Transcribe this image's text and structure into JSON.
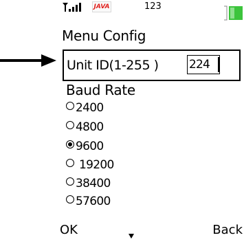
{
  "status_bar": {
    "signal_icon": "signal-strength-icon",
    "app_badge": "JAVA",
    "number": "123",
    "battery_icon": "battery-icon",
    "battery_color": "#3cc43c"
  },
  "screen": {
    "title": "Menu Config"
  },
  "form": {
    "unit_id_label": "Unit ID(1-255 )",
    "unit_id_value": "224",
    "baud_rate_label": "Baud Rate",
    "baud_options": [
      "2400",
      "4800",
      "9600",
      "19200",
      "38400",
      "57600"
    ],
    "baud_selected": "9600"
  },
  "softkeys": {
    "left": "OK",
    "right": "Back",
    "scroll_icon": "scroll-down-indicator-icon"
  },
  "annotation": {
    "pointer_icon": "arrow-right-icon"
  }
}
